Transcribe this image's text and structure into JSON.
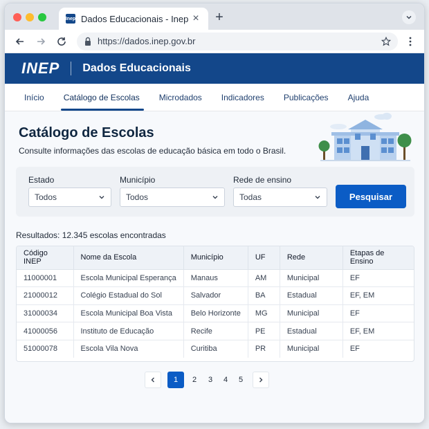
{
  "browser": {
    "tab_title": "Dados Educacionais - Inep",
    "tab_favicon_text": "Inep",
    "url": "https://dados.inep.gov.br"
  },
  "site": {
    "logo": "INEP",
    "title": "Dados Educacionais",
    "brand_color": "#13478a"
  },
  "nav": {
    "items": [
      {
        "label": "Início",
        "active": false
      },
      {
        "label": "Catálogo de Escolas",
        "active": true
      },
      {
        "label": "Microdados",
        "active": false
      },
      {
        "label": "Indicadores",
        "active": false
      },
      {
        "label": "Publicações",
        "active": false
      },
      {
        "label": "Ajuda",
        "active": false
      }
    ]
  },
  "page": {
    "title": "Catálogo de Escolas",
    "subtitle": "Consulte informações das escolas de educação básica em todo o Brasil."
  },
  "filters": {
    "estado": {
      "label": "Estado",
      "value": "Todos"
    },
    "municipio": {
      "label": "Município",
      "value": "Todos"
    },
    "rede": {
      "label": "Rede de ensino",
      "value": "Todas"
    },
    "search_label": "Pesquisar",
    "accent_color": "#0b5cc5"
  },
  "results": {
    "text": "Resultados: 12.345 escolas encontradas"
  },
  "table": {
    "headers": [
      "Código INEP",
      "Nome da Escola",
      "Município",
      "UF",
      "Rede",
      "Etapas de Ensino"
    ],
    "rows": [
      [
        "11000001",
        "Escola Municipal Esperança",
        "Manaus",
        "AM",
        "Municipal",
        "EF"
      ],
      [
        "21000012",
        "Colégio Estadual do Sol",
        "Salvador",
        "BA",
        "Estadual",
        "EF, EM"
      ],
      [
        "31000034",
        "Escola Municipal Boa Vista",
        "Belo Horizonte",
        "MG",
        "Municipal",
        "EF"
      ],
      [
        "41000056",
        "Instituto de Educação",
        "Recife",
        "PE",
        "Estadual",
        "EF, EM"
      ],
      [
        "51000078",
        "Escola Vila Nova",
        "Curitiba",
        "PR",
        "Municipal",
        "EF"
      ]
    ]
  },
  "pagination": {
    "pages": [
      "1",
      "2",
      "3",
      "4",
      "5"
    ],
    "current": "1"
  },
  "icons": {
    "back": "arrow-left-icon",
    "forward": "arrow-right-icon",
    "reload": "reload-icon",
    "lock": "lock-icon",
    "bookmark": "star-icon",
    "menu": "kebab-menu-icon",
    "dropdown": "chevron-down-icon"
  }
}
